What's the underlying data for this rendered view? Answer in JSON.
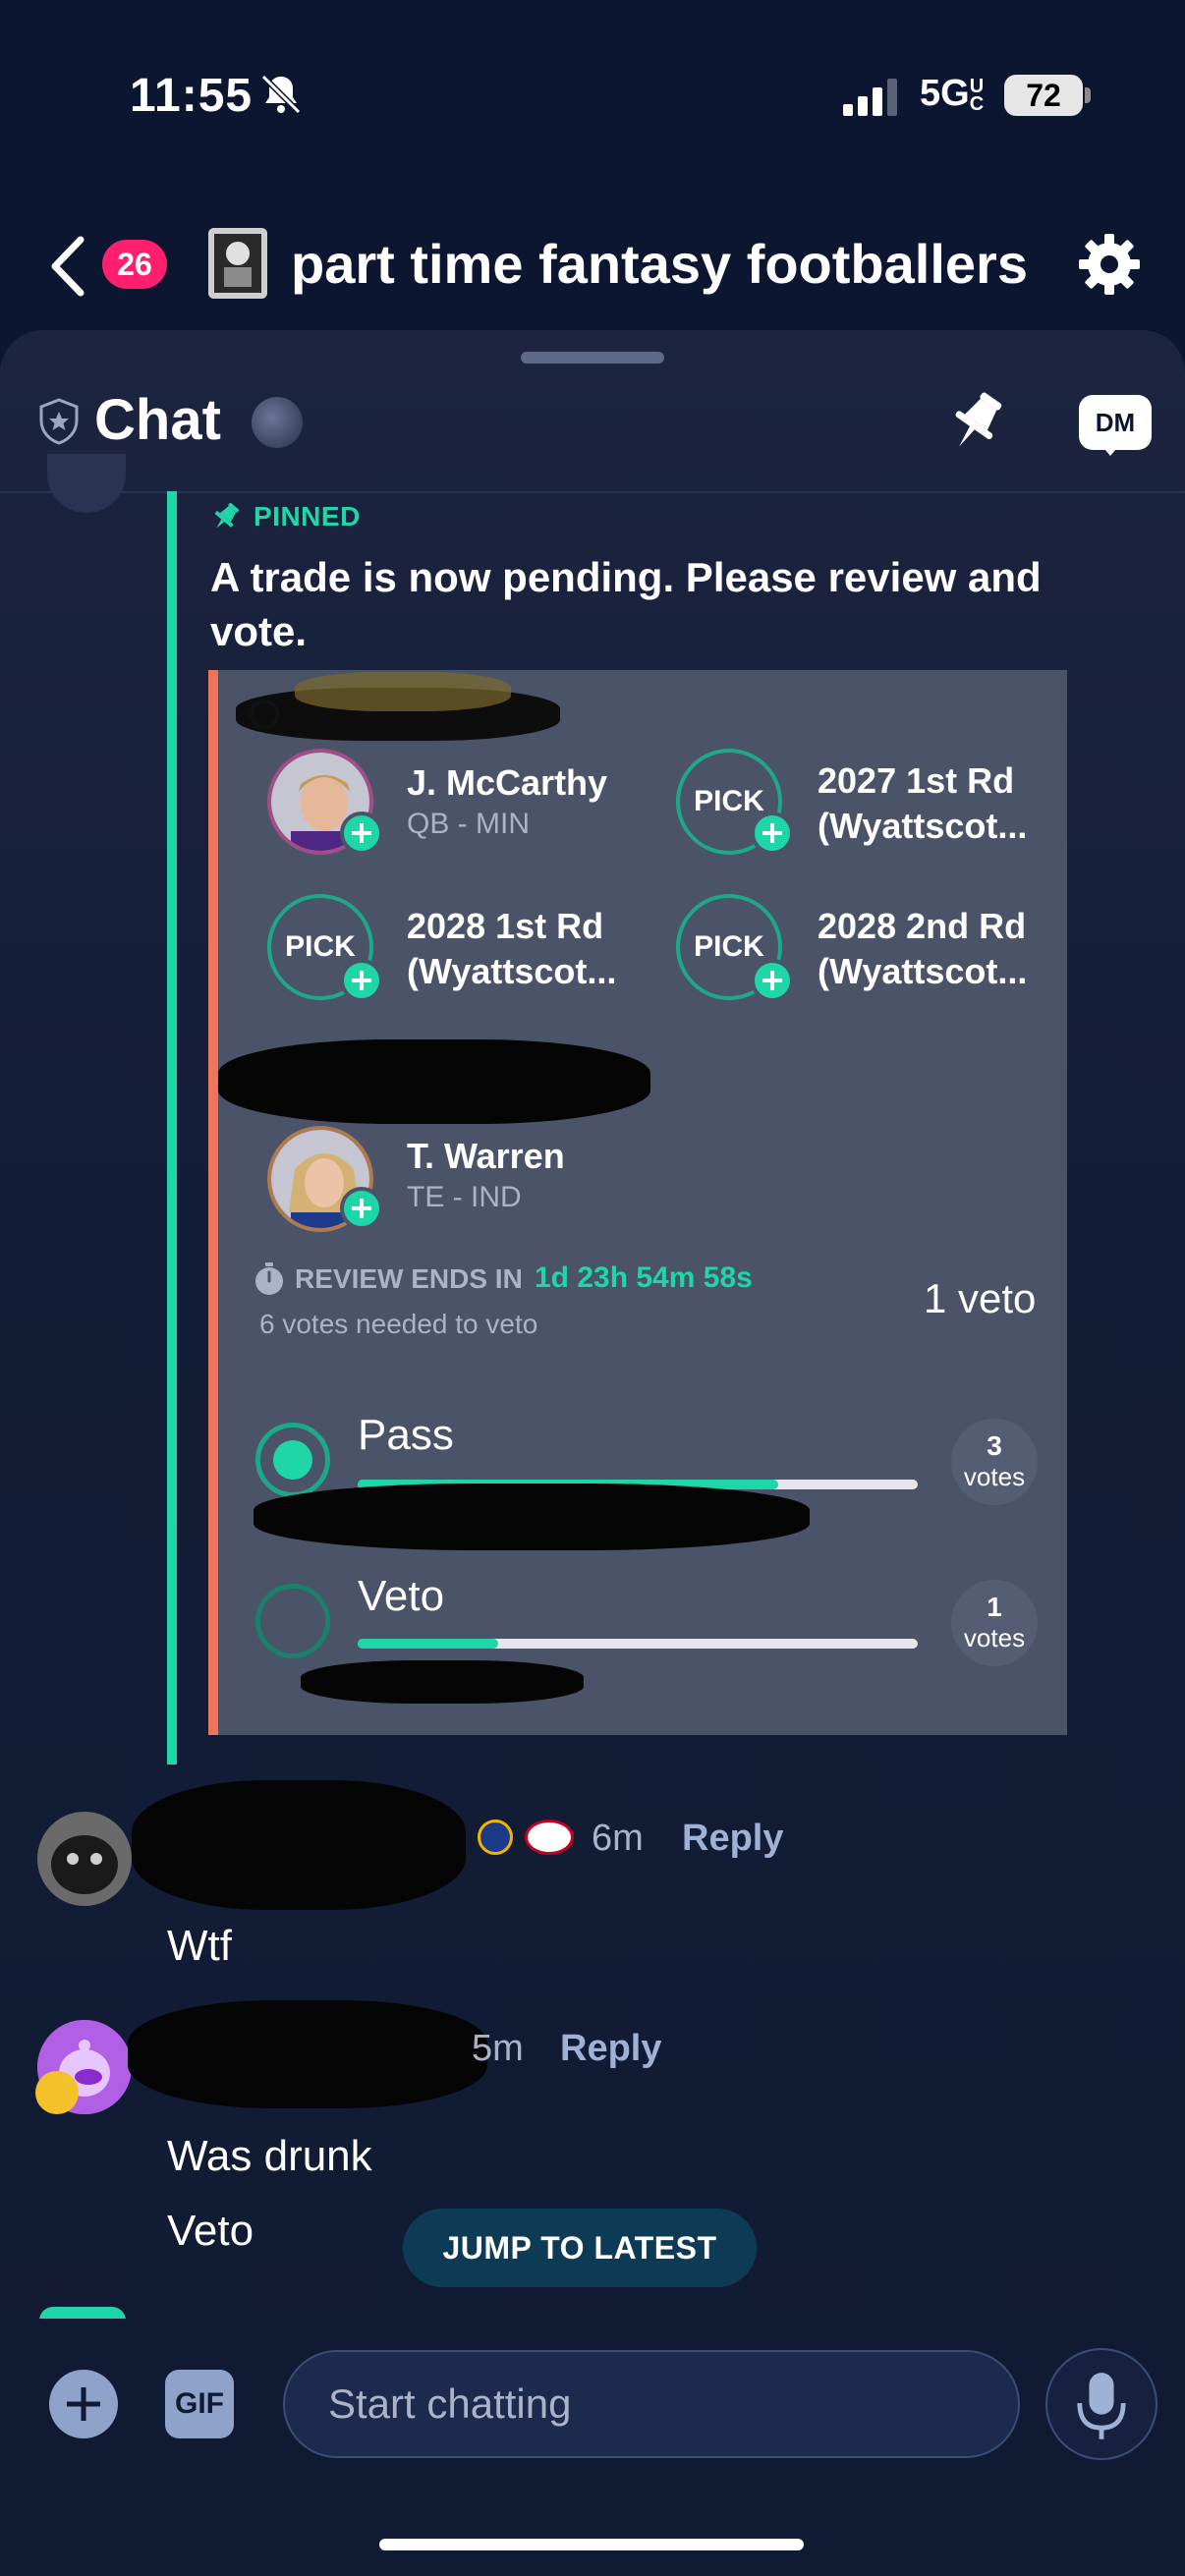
{
  "status_bar": {
    "time": "11:55",
    "network": "5G",
    "network_suffix": "UC",
    "battery": "72"
  },
  "header": {
    "notification_count": "26",
    "league_name": "part time fantasy footballers"
  },
  "chat_header": {
    "title": "Chat",
    "dm_label": "DM"
  },
  "pinned": {
    "label": "PINNED",
    "message": "A trade is now pending. Please review and vote.",
    "side_a_assets": [
      {
        "name": "J. McCarthy",
        "sub": "QB - MIN",
        "type": "player"
      },
      {
        "name": "2027 1st Rd",
        "sub": "(Wyattscot...",
        "type": "pick"
      },
      {
        "name": "2028 1st Rd",
        "sub": "(Wyattscot...",
        "type": "pick"
      },
      {
        "name": "2028 2nd Rd",
        "sub": "(Wyattscot...",
        "type": "pick"
      }
    ],
    "side_b_assets": [
      {
        "name": "T. Warren",
        "sub": "TE - IND",
        "type": "player"
      }
    ],
    "pick_label": "PICK",
    "review_label": "REVIEW ENDS IN",
    "review_countdown": "1d 23h 54m 58s",
    "votes_needed": "6 votes needed to veto",
    "veto_count": "1 veto",
    "options": [
      {
        "label": "Pass",
        "votes": "3",
        "votes_word": "votes",
        "fill": 0.75,
        "selected": true
      },
      {
        "label": "Veto",
        "votes": "1",
        "votes_word": "votes",
        "fill": 0.25,
        "selected": false
      }
    ]
  },
  "messages": [
    {
      "time_ago": "6m",
      "reply": "Reply",
      "lines": [
        "Wtf"
      ]
    },
    {
      "time_ago": "5m",
      "reply": "Reply",
      "lines": [
        "Was drunk",
        "Veto"
      ]
    }
  ],
  "jump_label": "JUMP TO LATEST",
  "composer": {
    "gif_label": "GIF",
    "placeholder": "Start chatting"
  },
  "colors": {
    "accent": "#1fd6a8",
    "badge": "#ff1f6e",
    "trade_stripe": "#f0745a",
    "background": "#0d1630"
  }
}
